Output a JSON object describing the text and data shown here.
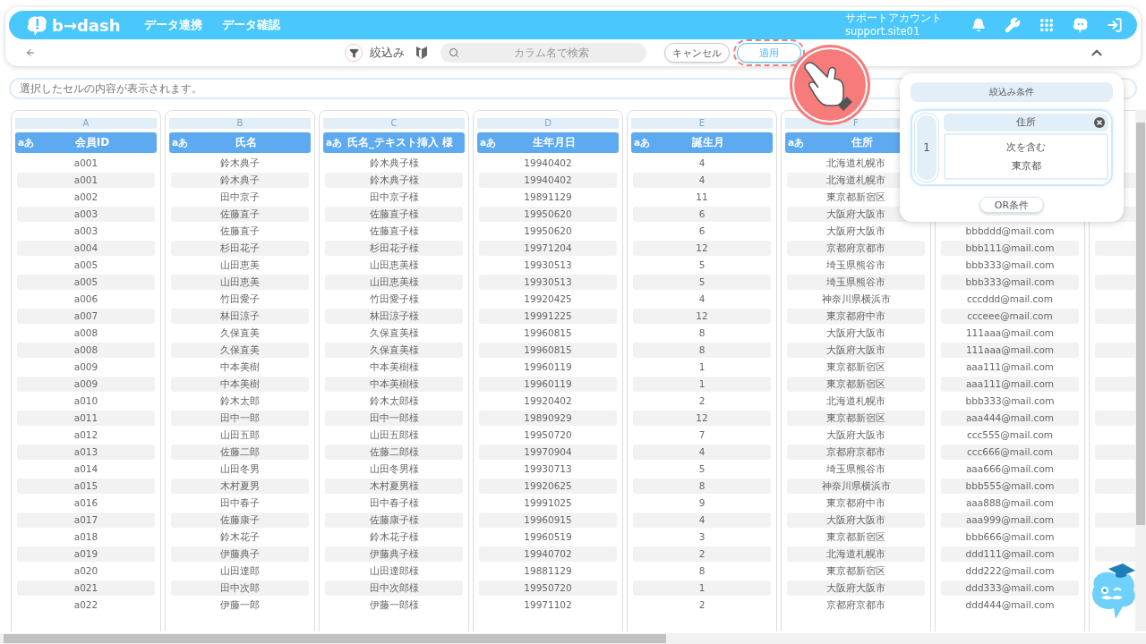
{
  "nav": {
    "logo": "b→dash",
    "menu": [
      "データ連携",
      "データ確認"
    ],
    "account": {
      "name": "サポートアカウント",
      "id": "support.site01"
    }
  },
  "toolbar": {
    "filter_label": "絞込み",
    "search_placeholder": "カラム名で検索",
    "cancel": "キャンセル",
    "apply": {
      "label": "適用",
      "highlighted": true
    }
  },
  "cell_field": {
    "placeholder": "選択したセルの内容が表示されます。"
  },
  "columns": [
    {
      "letter": "A",
      "type_badge": "aあ",
      "name": "会員ID",
      "cells": [
        "a001",
        "a001",
        "a002",
        "a003",
        "a003",
        "a004",
        "a005",
        "a005",
        "a006",
        "a007",
        "a008",
        "a008",
        "a009",
        "a009",
        "a010",
        "a011",
        "a012",
        "a013",
        "a014",
        "a015",
        "a016",
        "a017",
        "a018",
        "a019",
        "a020",
        "a021",
        "a022"
      ]
    },
    {
      "letter": "B",
      "type_badge": "aあ",
      "name": "氏名",
      "cells": [
        "鈴木典子",
        "鈴木典子",
        "田中京子",
        "佐藤直子",
        "佐藤直子",
        "杉田花子",
        "山田恵美",
        "山田恵美",
        "竹田愛子",
        "林田涼子",
        "久保直美",
        "久保直美",
        "中本美樹",
        "中本美樹",
        "鈴木太郎",
        "田中一郎",
        "山田五郎",
        "佐藤二郎",
        "山田冬男",
        "木村夏男",
        "田中春子",
        "佐藤康子",
        "鈴木花子",
        "伊藤典子",
        "山田達郎",
        "田中次郎",
        "伊藤一郎"
      ]
    },
    {
      "letter": "C",
      "type_badge": "aあ",
      "name": "氏名_テキスト挿入 様",
      "cells": [
        "鈴木典子様",
        "鈴木典子様",
        "田中京子様",
        "佐藤直子様",
        "佐藤直子様",
        "杉田花子様",
        "山田恵美様",
        "山田恵美様",
        "竹田愛子様",
        "林田涼子様",
        "久保直美様",
        "久保直美様",
        "中本美樹様",
        "中本美樹様",
        "鈴木太郎様",
        "田中一郎様",
        "山田五郎様",
        "佐藤二郎様",
        "山田冬男様",
        "木村夏男様",
        "田中春子様",
        "佐藤康子様",
        "鈴木花子様",
        "伊藤典子様",
        "山田達郎様",
        "田中次郎様",
        "伊藤一郎様"
      ]
    },
    {
      "letter": "D",
      "type_badge": "aあ",
      "name": "生年月日",
      "cells": [
        "19940402",
        "19940402",
        "19891129",
        "19950620",
        "19950620",
        "19971204",
        "19930513",
        "19930513",
        "19920425",
        "19991225",
        "19960815",
        "19960815",
        "19960119",
        "19960119",
        "19920402",
        "19890929",
        "19950720",
        "19970904",
        "19930713",
        "19920625",
        "19991025",
        "19960915",
        "19960519",
        "19940702",
        "19881129",
        "19950720",
        "19971102"
      ]
    },
    {
      "letter": "E",
      "type_badge": "aあ",
      "name": "誕生月",
      "cells": [
        "4",
        "4",
        "11",
        "6",
        "6",
        "12",
        "5",
        "5",
        "4",
        "12",
        "8",
        "8",
        "1",
        "1",
        "2",
        "12",
        "7",
        "4",
        "5",
        "8",
        "9",
        "4",
        "3",
        "2",
        "8",
        "1",
        "2"
      ]
    },
    {
      "letter": "F",
      "type_badge": "aあ",
      "name": "住所",
      "cells": [
        "北海道札幌市",
        "北海道札幌市",
        "東京都新宿区",
        "大阪府大阪市",
        "大阪府大阪市",
        "京都府京都市",
        "埼玉県熊谷市",
        "埼玉県熊谷市",
        "神奈川県横浜市",
        "東京都府中市",
        "大阪府大阪市",
        "大阪府大阪市",
        "東京都新宿区",
        "東京都新宿区",
        "北海道札幌市",
        "東京都新宿区",
        "大阪府大阪市",
        "京都府京都市",
        "埼玉県熊谷市",
        "神奈川県横浜市",
        "東京都府中市",
        "大阪府大阪市",
        "東京都新宿区",
        "北海道札幌市",
        "東京都新宿区",
        "大阪府大阪市",
        "京都府京都市"
      ]
    },
    {
      "cells": [
        "bbbddd@mail.com",
        "bbb111@mail.com",
        "bbb333@mail.com",
        "bbb333@mail.com",
        "cccddd@mail.com",
        "ccceee@mail.com",
        "111aaa@mail.com",
        "111aaa@mail.com",
        "aaa111@mail.com",
        "aaa111@mail.com",
        "bbb333@mail.com",
        "aaa444@mail.com",
        "ccc555@mail.com",
        "ccc666@mail.com",
        "aaa666@mail.com",
        "bbb555@mail.com",
        "aaa888@mail.com",
        "aaa999@mail.com",
        "bbb666@mail.com",
        "ddd111@mail.com",
        "ddd222@mail.com",
        "ddd333@mail.com",
        "ddd444@mail.com"
      ]
    }
  ],
  "filter_panel": {
    "title": "絞込み条件",
    "conditions": [
      {
        "index": "1",
        "column": "住所",
        "operator": "次を含む",
        "value": "東京都"
      }
    ],
    "or_button": "OR条件"
  }
}
